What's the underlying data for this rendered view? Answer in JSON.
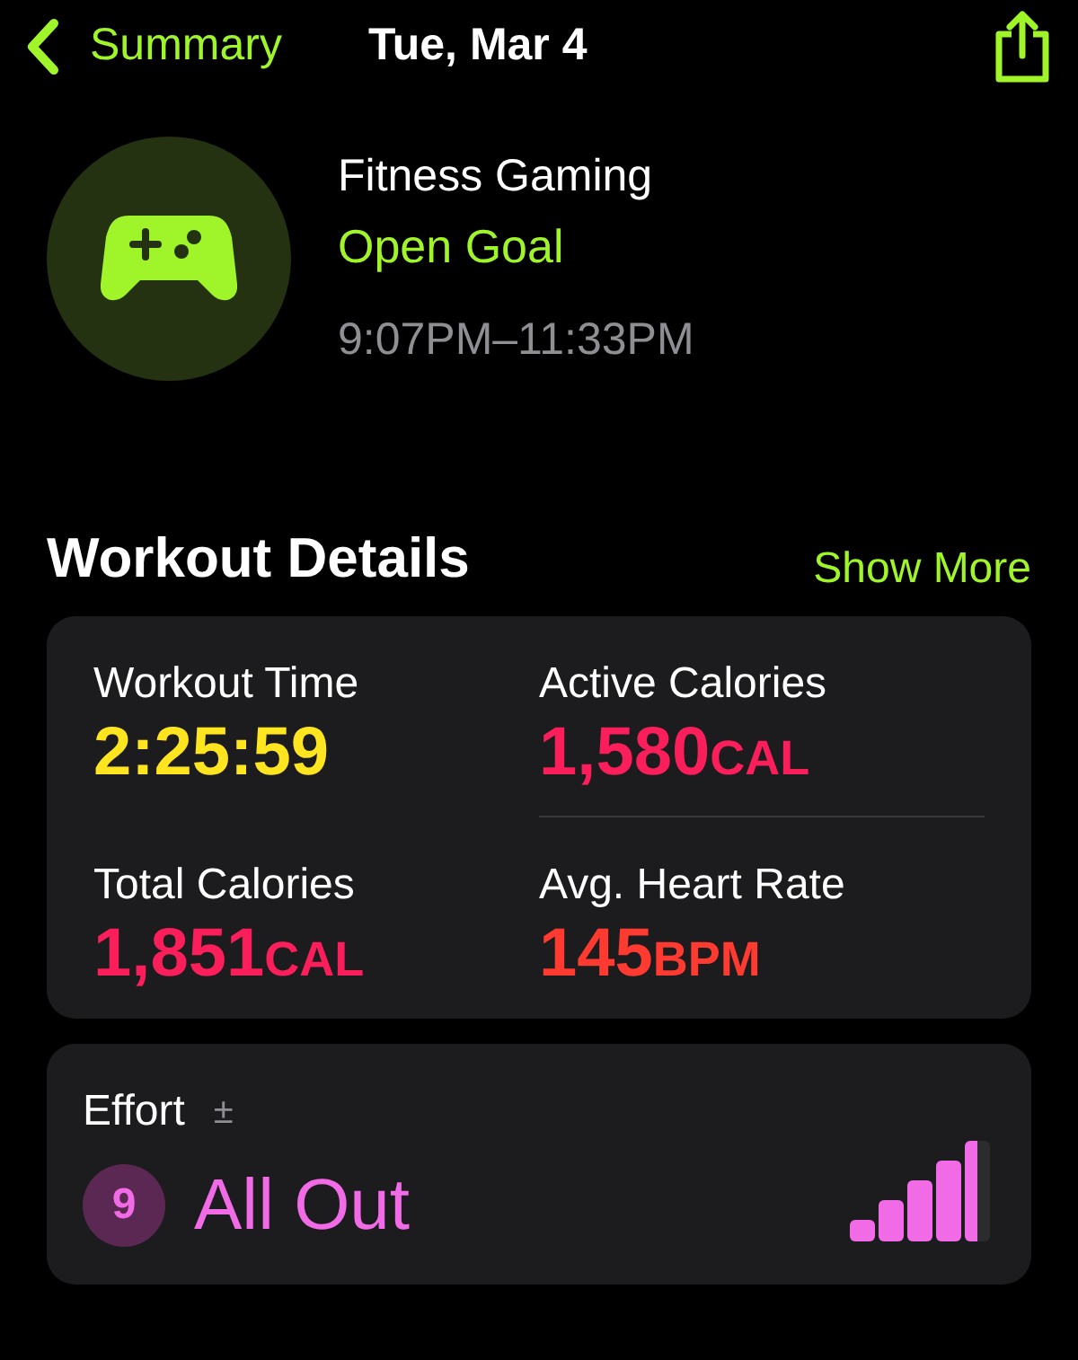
{
  "nav": {
    "back_label": "Summary",
    "title": "Tue, Mar 4"
  },
  "workout": {
    "name": "Fitness Gaming",
    "goal": "Open Goal",
    "time_range": "9:07PM–11:33PM"
  },
  "details": {
    "title": "Workout Details",
    "show_more": "Show More",
    "metrics": [
      {
        "label": "Workout Time",
        "value": "2:25:59",
        "color": "#ffe420"
      },
      {
        "label": "Active Calories",
        "value": "1,580",
        "unit": "CAL",
        "color": "#fa1e5a"
      },
      {
        "label": "Total Calories",
        "value": "1,851",
        "unit": "CAL",
        "color": "#fa1e5a"
      },
      {
        "label": "Avg. Heart Rate",
        "value": "145",
        "unit": "BPM",
        "color": "#ff3a30"
      }
    ]
  },
  "effort": {
    "label": "Effort",
    "adjust": "±",
    "score": "9",
    "rating": "All Out"
  }
}
